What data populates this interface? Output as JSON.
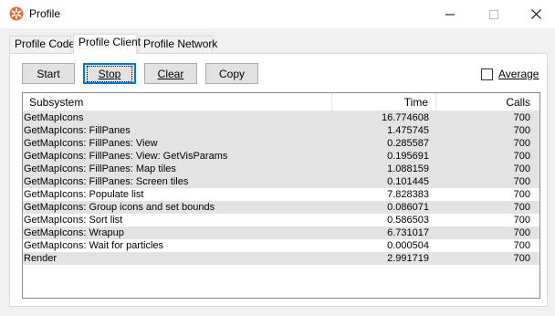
{
  "window": {
    "title": "Profile",
    "controls": {
      "minimize": "—",
      "maximize": "☐",
      "close": "✕"
    }
  },
  "tabs": [
    {
      "label": "Profile Code",
      "active": false
    },
    {
      "label": "Profile Client",
      "active": true
    },
    {
      "label": "Profile Network",
      "active": false
    }
  ],
  "toolbar": {
    "start_label": "Start",
    "stop_label": "Stop",
    "clear_label": "Clear",
    "copy_label": "Copy",
    "average_label": "Average",
    "average_checked": false
  },
  "table": {
    "columns": [
      "Subsystem",
      "Time",
      "Calls"
    ],
    "rows": [
      {
        "subsystem": "GetMapIcons",
        "time": "16.774608",
        "calls": "700"
      },
      {
        "subsystem": "GetMapIcons: FillPanes",
        "time": "1.475745",
        "calls": "700"
      },
      {
        "subsystem": "GetMapIcons: FillPanes: View",
        "time": "0.285587",
        "calls": "700"
      },
      {
        "subsystem": "GetMapIcons: FillPanes: View: GetVisParams",
        "time": "0.195691",
        "calls": "700"
      },
      {
        "subsystem": "GetMapIcons: FillPanes: Map tiles",
        "time": "1.088159",
        "calls": "700"
      },
      {
        "subsystem": "GetMapIcons: FillPanes: Screen tiles",
        "time": "0.101445",
        "calls": "700"
      },
      {
        "subsystem": "GetMapIcons: Populate list",
        "time": "7.828383",
        "calls": "700"
      },
      {
        "subsystem": "GetMapIcons: Group icons and set bounds",
        "time": "0.086071",
        "calls": "700"
      },
      {
        "subsystem": "GetMapIcons: Sort list",
        "time": "0.586503",
        "calls": "700"
      },
      {
        "subsystem": "GetMapIcons: Wrapup",
        "time": "6.731017",
        "calls": "700"
      },
      {
        "subsystem": "GetMapIcons: Wait for particles",
        "time": "0.000504",
        "calls": "700"
      },
      {
        "subsystem": "Render",
        "time": "2.991719",
        "calls": "700"
      }
    ]
  },
  "colors": {
    "row_alt": "#e3e3e3",
    "focus_border": "#0078d7",
    "app_icon": "#e06c3c"
  },
  "icons": {
    "app": "app-icon"
  }
}
